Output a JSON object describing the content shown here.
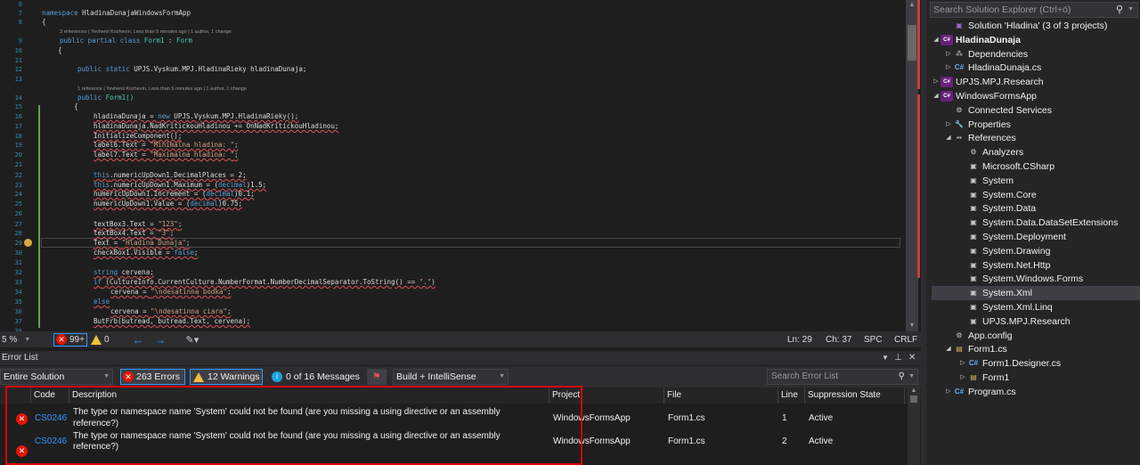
{
  "editor": {
    "line_numbers": [
      "6",
      "7",
      "8",
      "9",
      "10",
      "11",
      "12",
      "13",
      "14",
      "15",
      "16",
      "17",
      "18",
      "19",
      "20",
      "21",
      "22",
      "23",
      "24",
      "25",
      "26",
      "27",
      "28",
      "29",
      "30",
      "31",
      "32",
      "33",
      "34",
      "35",
      "36",
      "37",
      "38"
    ],
    "codelens_1": "3 references | Yevhenii Kozhevin, Less than 5 minutes ago | 1 author, 1 change",
    "codelens_2": "1 reference | Yevhenii Kozhevin, Less than 5 minutes ago | 1 author, 1 change",
    "lines": {
      "ns_kw": "namespace",
      "ns_name": " HladinaDunajaWindowsFormApp",
      "open_ns": "{",
      "cls_kw": "public partial class",
      "cls_name": "Form1",
      "cls_sep": " : ",
      "cls_base": "Form",
      "open_cls": "    {",
      "field_kw": "public static",
      "field_rest": " UPJS.Vyskum.MPJ.HladinaRieky hladinaDunaja;",
      "ctor_kw": "public",
      "ctor_name": " Form1()",
      "open_ctor": "        {",
      "l16a": "hladinaDunaja = ",
      "l16b": "new",
      "l16c": " UPJS.Vyskum.MPJ.HladinaRieky();",
      "l17": "hladinaDunaja.NadKritickouHladinou += OnNadKritickouHladinou;",
      "l18": "InitializeComponent();",
      "l19a": "label6.Text = ",
      "l19b": "\"Minimalna hladina: \"",
      "l19c": ";",
      "l20a": "label7.Text = ",
      "l20b": "\"Maximalna hladina: \"",
      "l20c": ";",
      "l22a": "this",
      "l22b": ".numericUpDown1.DecimalPlaces = 2;",
      "l23a": "this",
      "l23b": ".numericUpDown1.Maximum = (",
      "l23c": "decimal",
      "l23d": ")1.5;",
      "l24a": "numericUpDown1.Increment = (",
      "l24b": "decimal",
      "l24c": ")0.1;",
      "l25a": "numericUpDown1.Value = (",
      "l25b": "decimal",
      "l25c": ")0.75;",
      "l27a": "textBox3.Text = ",
      "l27b": "\"123\"",
      "l27c": ";",
      "l28a": "textBox4.Text = ",
      "l28b": "\"3\"",
      "l28c": ";",
      "l29a": "Text = ",
      "l29b": "\"Hladina Dunaja\"",
      "l29c": ";",
      "l30a": "checkBox1.Visible = ",
      "l30b": "false",
      "l30c": ";",
      "l32a": "string",
      "l32b": " cervena;",
      "l33a": "if",
      "l33b": " (CultureInfo.CurrentCulture.NumberFormat.NumberDecimalSeparator.ToString() == ",
      "l33c": "\".\"",
      "l33d": ")",
      "l34a": "cervena = ",
      "l34b": "\"\\ndesatinna bodka\"",
      "l34c": ";",
      "l35": "else",
      "l36a": "cervena = ",
      "l36b": "\"\\ndesatinna ciara\"",
      "l36c": ";",
      "l37": "ButFrb(butread, butread.Text, cervena);"
    }
  },
  "status": {
    "zoom": "5 %",
    "errors": "99+",
    "warnings": "0",
    "ln": "Ln: 29",
    "ch": "Ch: 37",
    "spc": "SPC",
    "crlf": "CRLF"
  },
  "error_list": {
    "title": "Error List",
    "scope": "Entire Solution",
    "errors_btn": "263 Errors",
    "warnings_btn": "12 Warnings",
    "messages_btn": "0 of 16 Messages",
    "build_combo": "Build + IntelliSense",
    "search_placeholder": "Search Error List",
    "columns": [
      "Code",
      "Description",
      "Project",
      "File",
      "Line",
      "Suppression State"
    ],
    "rows": [
      {
        "code": "CS0246",
        "desc1": "The type or namespace name 'System' could not be found (are you missing a using directive or an assembly",
        "desc2": "reference?)",
        "project": "WindowsFormsApp",
        "file": "Form1.cs",
        "line": "1",
        "state": "Active"
      },
      {
        "code": "CS0246",
        "desc1": "The type or namespace name 'System' could not be found (are you missing a using directive or an assembly",
        "desc2": "reference?)",
        "project": "WindowsFormsApp",
        "file": "Form1.cs",
        "line": "2",
        "state": "Active"
      }
    ]
  },
  "solution_explorer": {
    "search_placeholder": "Search Solution Explorer (Ctrl+ö)",
    "nodes": [
      {
        "label": "Solution 'Hladina' (3 of 3 projects)",
        "icon": "solution-icon"
      },
      {
        "label": "HladinaDunaja",
        "icon": "csharp-project-icon"
      },
      {
        "label": "Dependencies",
        "icon": "dependencies-icon"
      },
      {
        "label": "HladinaDunaja.cs",
        "icon": "csharp-file-icon"
      },
      {
        "label": "UPJS.MPJ.Research",
        "icon": "csharp-project-icon"
      },
      {
        "label": "WindowsFormsApp",
        "icon": "csharp-project-icon"
      },
      {
        "label": "Connected Services",
        "icon": "connected-services-icon"
      },
      {
        "label": "Properties",
        "icon": "wrench-icon"
      },
      {
        "label": "References",
        "icon": "references-icon"
      },
      {
        "label": "Analyzers",
        "icon": "analyzers-icon"
      },
      {
        "label": "Microsoft.CSharp",
        "icon": "reference-warning-icon"
      },
      {
        "label": "System",
        "icon": "reference-warning-icon"
      },
      {
        "label": "System.Core",
        "icon": "reference-warning-icon"
      },
      {
        "label": "System.Data",
        "icon": "reference-warning-icon"
      },
      {
        "label": "System.Data.DataSetExtensions",
        "icon": "reference-warning-icon"
      },
      {
        "label": "System.Deployment",
        "icon": "reference-warning-icon"
      },
      {
        "label": "System.Drawing",
        "icon": "reference-warning-icon"
      },
      {
        "label": "System.Net.Http",
        "icon": "reference-warning-icon"
      },
      {
        "label": "System.Windows.Forms",
        "icon": "reference-warning-icon"
      },
      {
        "label": "System.Xml",
        "icon": "reference-warning-icon"
      },
      {
        "label": "System.Xml.Linq",
        "icon": "reference-warning-icon"
      },
      {
        "label": "UPJS.MPJ.Research",
        "icon": "reference-warning-icon"
      },
      {
        "label": "App.config",
        "icon": "config-file-icon"
      },
      {
        "label": "Form1.cs",
        "icon": "form-file-icon"
      },
      {
        "label": "Form1.Designer.cs",
        "icon": "csharp-file-icon"
      },
      {
        "label": "Form1",
        "icon": "form-icon"
      },
      {
        "label": "Program.cs",
        "icon": "csharp-file-icon"
      }
    ]
  },
  "colors": {
    "keyword": "#569cd6",
    "type": "#4ec9b0",
    "string": "#d69d85",
    "error": "#e51400",
    "highlight_box": "#e00000"
  }
}
